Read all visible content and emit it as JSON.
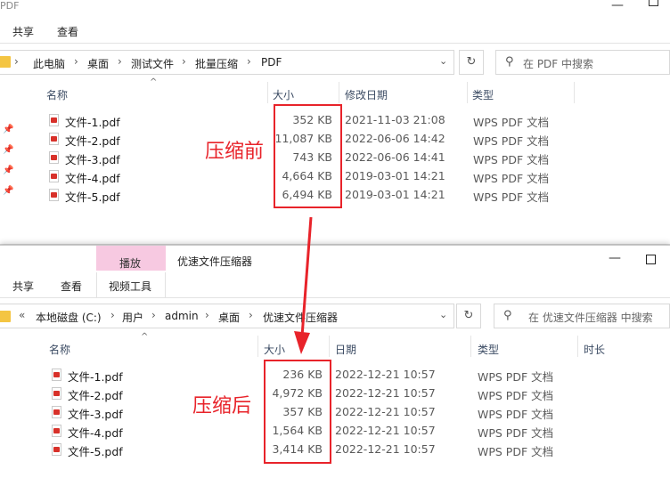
{
  "top_window": {
    "title": "PDF",
    "ribbon_tabs": [
      "共享",
      "查看"
    ],
    "breadcrumb": [
      "此电脑",
      "桌面",
      "测试文件",
      "批量压缩",
      "PDF"
    ],
    "search_placeholder": "在 PDF 中搜索",
    "columns": [
      "名称",
      "大小",
      "修改日期",
      "类型"
    ],
    "files": [
      {
        "name": "文件-1.pdf",
        "size": "352 KB",
        "date": "2021-11-03 21:08",
        "type": "WPS PDF 文档"
      },
      {
        "name": "文件-2.pdf",
        "size": "11,087 KB",
        "date": "2022-06-06 14:42",
        "type": "WPS PDF 文档"
      },
      {
        "name": "文件-3.pdf",
        "size": "743 KB",
        "date": "2022-06-06 14:41",
        "type": "WPS PDF 文档"
      },
      {
        "name": "文件-4.pdf",
        "size": "4,664 KB",
        "date": "2019-03-01 14:21",
        "type": "WPS PDF 文档"
      },
      {
        "name": "文件-5.pdf",
        "size": "6,494 KB",
        "date": "2019-03-01 14:21",
        "type": "WPS PDF 文档"
      }
    ],
    "annotation": "压缩前"
  },
  "bottom_window": {
    "title": "优速文件压缩器",
    "contextual_tab": "播放",
    "contextual_subtab": "视频工具",
    "ribbon_tabs": [
      "共享",
      "查看"
    ],
    "breadcrumb_prefix": "«",
    "breadcrumb": [
      "本地磁盘 (C:)",
      "用户",
      "admin",
      "桌面",
      "优速文件压缩器"
    ],
    "search_placeholder": "在 优速文件压缩器 中搜索",
    "columns": [
      "名称",
      "大小",
      "日期",
      "类型",
      "时长"
    ],
    "files": [
      {
        "name": "文件-1.pdf",
        "size": "236 KB",
        "date": "2022-12-21 10:57",
        "type": "WPS PDF 文档"
      },
      {
        "name": "文件-2.pdf",
        "size": "4,972 KB",
        "date": "2022-12-21 10:57",
        "type": "WPS PDF 文档"
      },
      {
        "name": "文件-3.pdf",
        "size": "357 KB",
        "date": "2022-12-21 10:57",
        "type": "WPS PDF 文档"
      },
      {
        "name": "文件-4.pdf",
        "size": "1,564 KB",
        "date": "2022-12-21 10:57",
        "type": "WPS PDF 文档"
      },
      {
        "name": "文件-5.pdf",
        "size": "3,414 KB",
        "date": "2022-12-21 10:57",
        "type": "WPS PDF 文档"
      }
    ],
    "annotation": "压缩后"
  },
  "icons": {
    "folder": "folder-icon",
    "refresh": "refresh-icon",
    "search": "search-icon",
    "chevron": "chevron-down-icon",
    "pin": "pin-icon",
    "file": "pdf-file-icon"
  },
  "colors": {
    "annotation_red": "#e8232a",
    "contextual_tab_pink": "#f7c9e1",
    "folder_yellow": "#f4c542"
  }
}
